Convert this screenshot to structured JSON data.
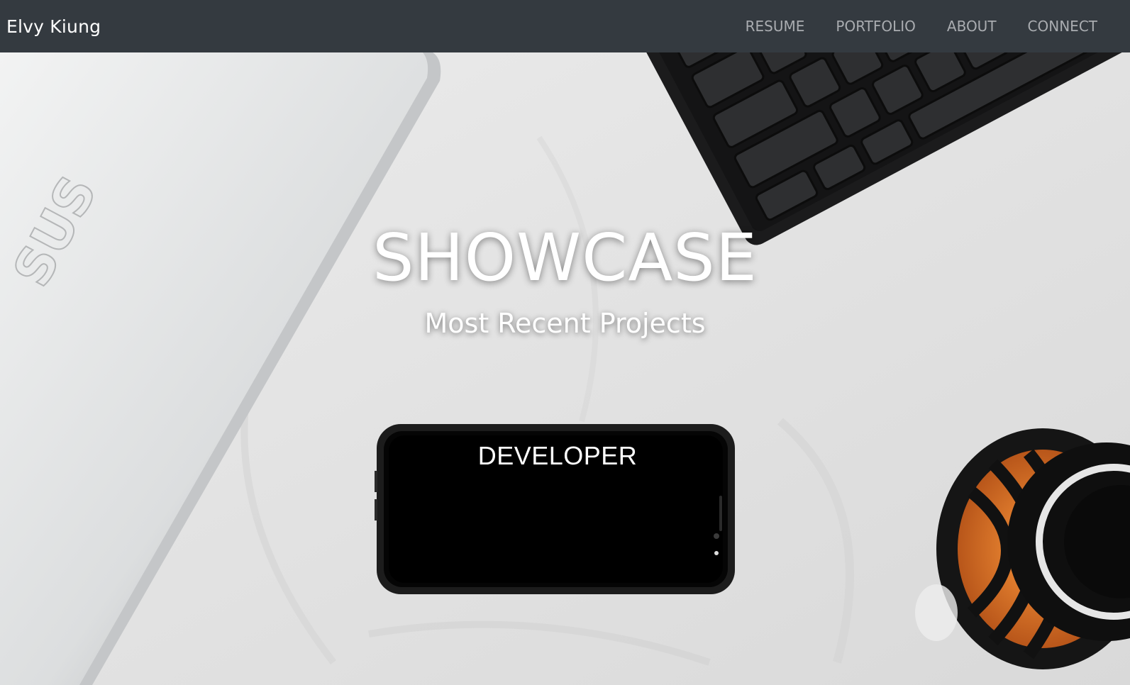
{
  "navbar": {
    "brand": "Elvy Kiung",
    "links": [
      {
        "label": "RESUME"
      },
      {
        "label": "PORTFOLIO"
      },
      {
        "label": "ABOUT"
      },
      {
        "label": "CONNECT"
      }
    ]
  },
  "hero": {
    "title": "SHOWCASE",
    "subtitle": "Most Recent Projects",
    "phone_screen_text": "DEVELOPER",
    "laptop_logo_text": "SUS"
  },
  "colors": {
    "navbar_bg": "#343a40",
    "nav_link": "#a9acb0",
    "brand_text": "#ffffff",
    "hero_text": "#ffffff"
  }
}
